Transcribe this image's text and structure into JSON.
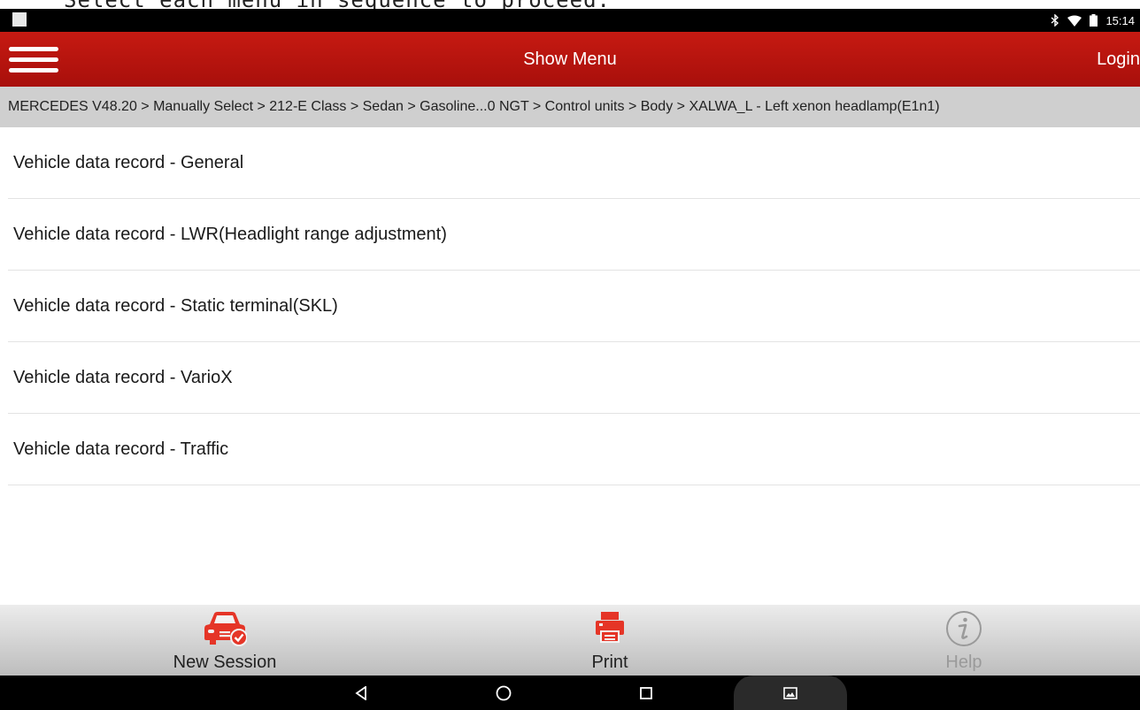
{
  "overlay_caption": "Select each menu in sequence to proceed.",
  "status_bar": {
    "time": "15:14",
    "icons": [
      "bluetooth-icon",
      "wifi-icon",
      "battery-icon"
    ]
  },
  "app_bar": {
    "title": "Show Menu",
    "login_label": "Login",
    "menu_icon": "hamburger-menu-icon",
    "background_color": "#b3130e"
  },
  "breadcrumb": "MERCEDES V48.20 > Manually Select > 212-E Class > Sedan > Gasoline...0 NGT > Control units > Body > XALWA_L - Left xenon headlamp(E1n1)",
  "menu_items": [
    {
      "label": "Vehicle data record - General"
    },
    {
      "label": "Vehicle data record - LWR(Headlight range adjustment)"
    },
    {
      "label": "Vehicle data record - Static terminal(SKL)"
    },
    {
      "label": "Vehicle data record - VarioX"
    },
    {
      "label": "Vehicle data record - Traffic"
    }
  ],
  "bottom_bar": {
    "new_session": {
      "label": "New Session",
      "icon": "car-check-icon"
    },
    "print": {
      "label": "Print",
      "icon": "printer-icon"
    },
    "help": {
      "label": "Help",
      "icon": "info-icon",
      "enabled": false
    },
    "accent_color": "#e53527"
  },
  "nav_bar": {
    "buttons": [
      "back-triangle-icon",
      "home-circle-icon",
      "recents-square-icon",
      "screenshot-icon"
    ]
  }
}
